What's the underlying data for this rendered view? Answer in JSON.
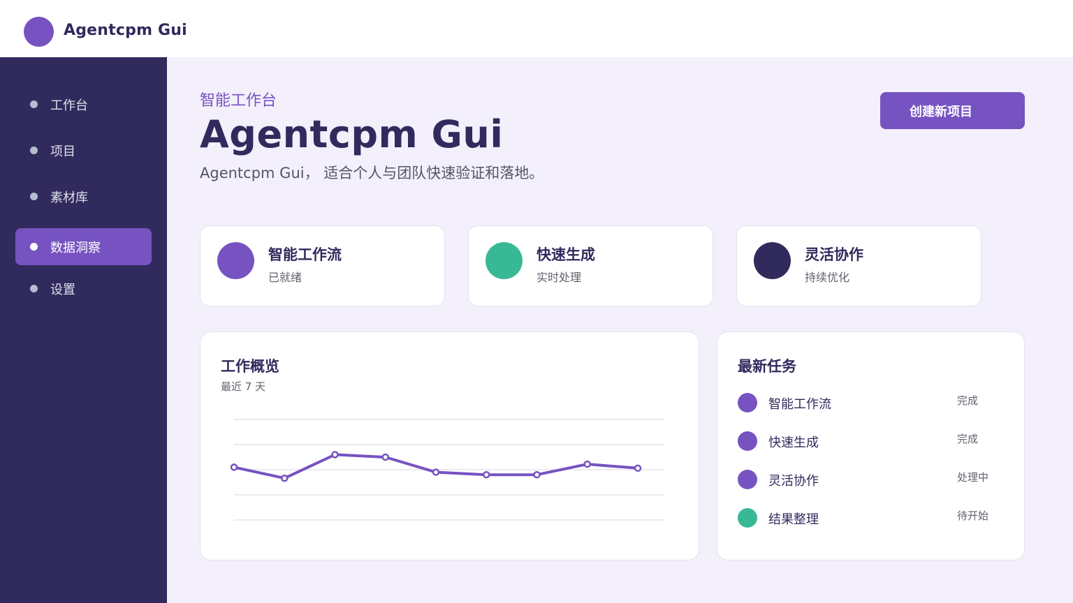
{
  "app": {
    "title": "Agentcpm Gui"
  },
  "sidebar": {
    "items": [
      {
        "label": "工作台",
        "active": false
      },
      {
        "label": "项目",
        "active": false
      },
      {
        "label": "素材库",
        "active": false
      },
      {
        "label": "数据洞察",
        "active": true
      },
      {
        "label": "设置",
        "active": false
      }
    ]
  },
  "hero": {
    "eyebrow": "智能工作台",
    "title": "Agentcpm Gui",
    "subtitle": "Agentcpm Gui， 适合个人与团队快速验证和落地。",
    "button_label": "创建新项目"
  },
  "features": [
    {
      "title": "智能工作流",
      "status": "已就绪",
      "color": "#7653c1"
    },
    {
      "title": "快速生成",
      "status": "实时处理",
      "color": "#38b895"
    },
    {
      "title": "灵活协作",
      "status": "持续优化",
      "color": "#312a5c"
    }
  ],
  "overview": {
    "title": "工作概览",
    "subtitle": "最近 7 天"
  },
  "chart_data": {
    "type": "line",
    "title": "工作概览",
    "subtitle": "最近 7 天",
    "xlabel": "",
    "ylabel": "",
    "x": [
      1,
      2,
      3,
      4,
      5,
      6,
      7,
      8,
      9
    ],
    "values": [
      55,
      33,
      80,
      75,
      45,
      40,
      40,
      61,
      53
    ],
    "ylim": [
      -50,
      150
    ],
    "grid": true,
    "color": "#7653c1"
  },
  "tasks": {
    "title": "最新任务",
    "items": [
      {
        "name": "智能工作流",
        "status": "完成",
        "color": "#7653c1"
      },
      {
        "name": "快速生成",
        "status": "完成",
        "color": "#7653c1"
      },
      {
        "name": "灵活协作",
        "status": "处理中",
        "color": "#7653c1"
      },
      {
        "name": "结果整理",
        "status": "待开始",
        "color": "#38b895"
      }
    ]
  },
  "colors": {
    "accent": "#7653c1",
    "sidebar": "#312a5c",
    "teal": "#38b895",
    "background": "#f3effb"
  }
}
